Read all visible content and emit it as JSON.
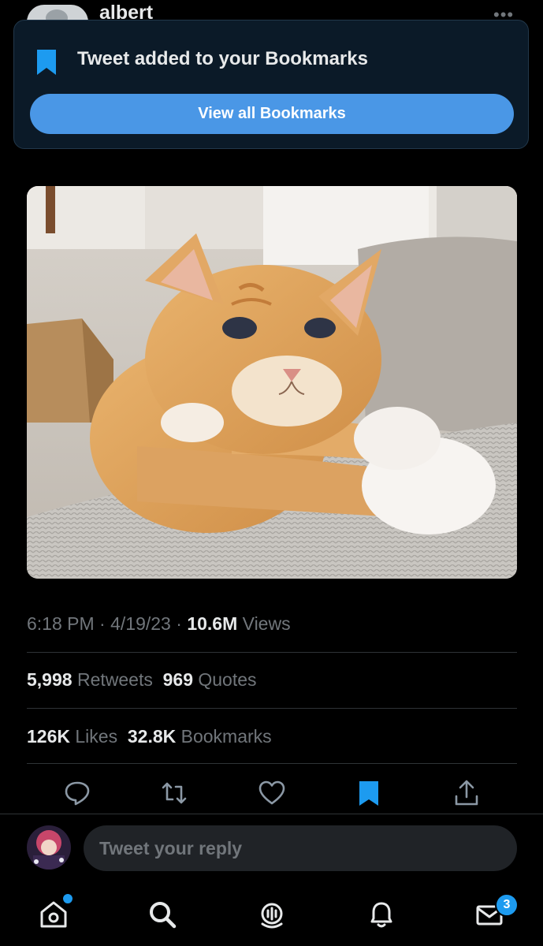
{
  "header": {
    "name": "albert"
  },
  "toast": {
    "message": "Tweet added to your Bookmarks",
    "button_label": "View all Bookmarks"
  },
  "tweet": {
    "time": "6:18 PM",
    "sep1": "·",
    "date": "4/19/23",
    "sep2": "·",
    "views_count": "10.6M",
    "views_label": "Views",
    "retweets_count": "5,998",
    "retweets_label": "Retweets",
    "quotes_count": "969",
    "quotes_label": "Quotes",
    "likes_count": "126K",
    "likes_label": "Likes",
    "bookmarks_count": "32.8K",
    "bookmarks_label": "Bookmarks"
  },
  "actions": [
    "reply-icon",
    "retweet-icon",
    "like-icon",
    "bookmark-icon",
    "share-icon"
  ],
  "reply": {
    "placeholder": "Tweet your reply"
  },
  "tabbar": {
    "tabs": [
      "home-icon",
      "search-icon",
      "spaces-icon",
      "notifications-icon",
      "messages-icon"
    ],
    "messages_badge": "3"
  },
  "colors": {
    "accent": "#1d9bf0",
    "toast_button": "#4a97e6",
    "toast_bg": "#0b1a28",
    "muted": "#71767b"
  }
}
